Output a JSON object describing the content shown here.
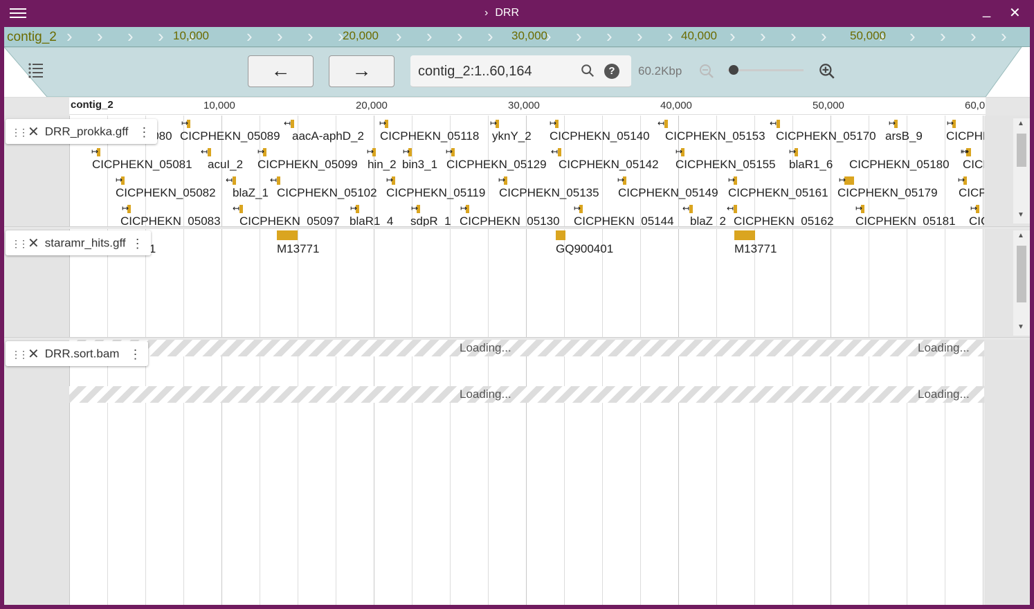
{
  "window": {
    "title": "DRR",
    "menu_icon": "hamburger-menu-icon",
    "minimize": "_",
    "close": "✕"
  },
  "overview": {
    "region": "contig_2",
    "ticks": [
      "10,000",
      "20,000",
      "30,000",
      "40,000",
      "50,000"
    ]
  },
  "navigation": {
    "back_label": "←",
    "forward_label": "→",
    "location_value": "contig_2:1..60,164",
    "bp_size": "60.2Kbp",
    "zoom_level": 0.02
  },
  "scale": {
    "region": "contig_2",
    "ticks": [
      "10,000",
      "20,000",
      "30,000",
      "40,000",
      "50,000",
      "60,0"
    ]
  },
  "tracks": [
    {
      "name": "DRR_prokka.gff",
      "rows": [
        [
          "CICPHEKN_05080",
          "CICPHEKN_05089",
          "aacA-aphD_2",
          "CICPHEKN_05118",
          "yknY_2",
          "CICPHEKN_05140",
          "CICPHEKN_05153",
          "CICPHEKN_05170",
          "arsB_9",
          "CICPHI"
        ],
        [
          "CICPHEKN_05081",
          "acuI_2",
          "CICPHEKN_05099",
          "hin_2",
          "bin3_1",
          "CICPHEKN_05129",
          "CICPHEKN_05142",
          "CICPHEKN_05155",
          "blaR1_6",
          "CICPHEKN_05180",
          "CICI"
        ],
        [
          "CICPHEKN_05082",
          "blaZ_1",
          "CICPHEKN_05102",
          "CICPHEKN_05119",
          "CICPHEKN_05135",
          "CICPHEKN_05149",
          "CICPHEKN_05161",
          "CICPHEKN_05179",
          "CICP"
        ],
        [
          "CICPHEKN_05083",
          "CICPHEKN_05097",
          "blaR1_4",
          "sdpR_1",
          "CICPHEKN_05130",
          "CICPHEKN_05144",
          "blaZ_2",
          "CICPHEKN_05162",
          "CICPHEKN_05181",
          "CIC"
        ]
      ]
    },
    {
      "name": "staramr_hits.gff",
      "features": [
        "GQ900401",
        "M13771",
        "GQ900401",
        "M13771"
      ]
    },
    {
      "name": "DRR.sort.bam",
      "loading_label": "Loading..."
    }
  ],
  "colors": {
    "titlebar": "#701b5f",
    "overview": "#a9cdd1",
    "feature": "#daa520"
  }
}
